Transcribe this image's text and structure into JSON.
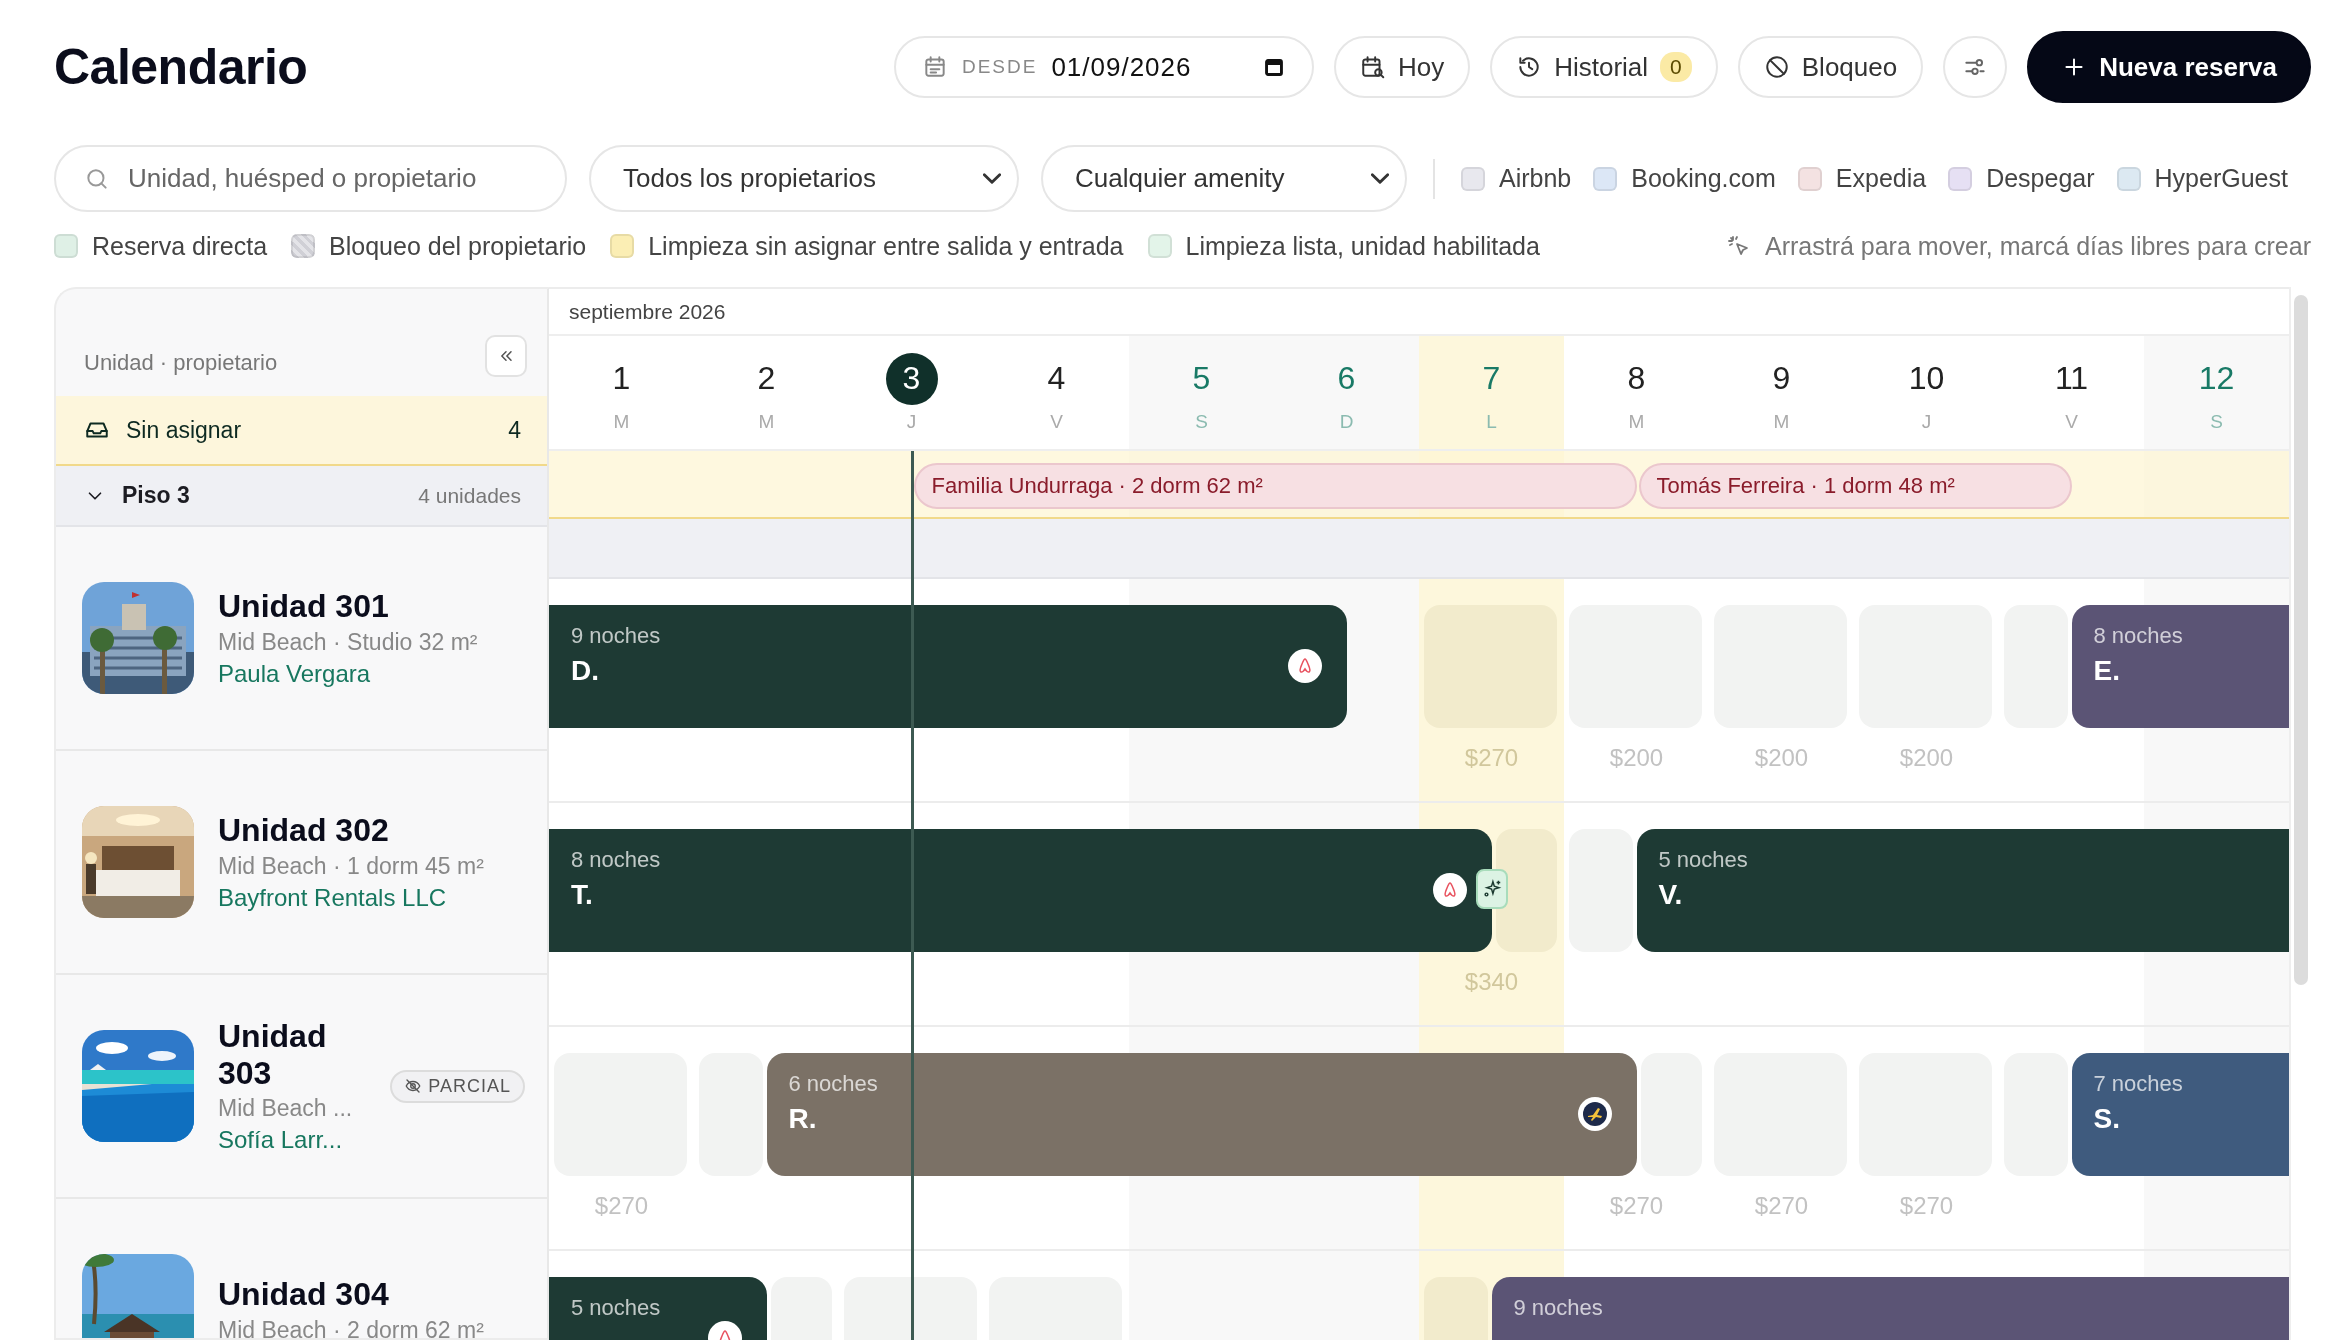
{
  "header": {
    "title": "Calendario",
    "date_field": {
      "label": "DESDE",
      "value": "01/09/2026"
    },
    "buttons": [
      {
        "kind": "today",
        "label": "Hoy"
      },
      {
        "kind": "history",
        "label": "Historial",
        "badge": "0"
      },
      {
        "kind": "block",
        "label": "Bloqueo"
      },
      {
        "kind": "settings"
      },
      {
        "kind": "new",
        "label": "Nueva reserva"
      }
    ]
  },
  "filters": {
    "search": {
      "placeholder": "Unidad, huésped o propietario"
    },
    "selects": [
      {
        "value": "Todos los propietarios"
      },
      {
        "value": "Cualquier amenity"
      }
    ],
    "channels": [
      {
        "label": "Airbnb",
        "color": "#e8e8ee",
        "checked": false
      },
      {
        "label": "Booking.com",
        "color": "#dce7f6",
        "checked": false
      },
      {
        "label": "Expedia",
        "color": "#f4e2e2",
        "checked": false
      },
      {
        "label": "Despegar",
        "color": "#e6e0f4",
        "checked": false
      },
      {
        "label": "HyperGuest",
        "color": "#dce9f2",
        "checked": false
      }
    ]
  },
  "legend": {
    "items": [
      {
        "label": "Reserva directa",
        "kind": "solid",
        "color": "#dff0e6"
      },
      {
        "label": "Bloqueo del propietario",
        "kind": "hatched",
        "color": "#e4e4e8"
      },
      {
        "label": "Limpieza sin asignar entre salida y entrada",
        "kind": "solid",
        "color": "#fbeeb4"
      },
      {
        "label": "Limpieza lista, unidad habilitada",
        "kind": "solid",
        "color": "#e3f4e9"
      }
    ],
    "hint": "Arrastrá para mover, marcá días libres para crear"
  },
  "sidebar": {
    "header": "Unidad · propietario",
    "unassigned": {
      "label": "Sin asignar",
      "count": "4"
    },
    "group": {
      "name": "Piso 3",
      "count": "4 unidades",
      "expanded": true
    },
    "units": [
      {
        "name": "Unidad 301",
        "details": "Mid Beach · Studio 32 m²",
        "owner": "Paula Vergara"
      },
      {
        "name": "Unidad 302",
        "details": "Mid Beach · 1 dorm 45 m²",
        "owner": "Bayfront Rentals LLC"
      },
      {
        "name": "Unidad 303",
        "details": "Mid Beach ...",
        "owner": "Sofía Larr...",
        "badge": "PARCIAL"
      },
      {
        "name": "Unidad 304",
        "details": "Mid Beach · 2 dorm 62 m²"
      }
    ]
  },
  "calendar": {
    "month": "septiembre 2026",
    "days": [
      {
        "number": "1",
        "weekday": "M",
        "weekend": false,
        "holiday": false,
        "today": false
      },
      {
        "number": "2",
        "weekday": "M",
        "weekend": false,
        "holiday": false,
        "today": false
      },
      {
        "number": "3",
        "weekday": "J",
        "weekend": false,
        "holiday": false,
        "today": true
      },
      {
        "number": "4",
        "weekday": "V",
        "weekend": false,
        "holiday": false,
        "today": false
      },
      {
        "number": "5",
        "weekday": "S",
        "weekend": true,
        "holiday": false,
        "today": false
      },
      {
        "number": "6",
        "weekday": "D",
        "weekend": true,
        "holiday": false,
        "today": false
      },
      {
        "number": "7",
        "weekday": "L",
        "weekend": false,
        "holiday": true,
        "today": false
      },
      {
        "number": "8",
        "weekday": "M",
        "weekend": false,
        "holiday": false,
        "today": false
      },
      {
        "number": "9",
        "weekday": "M",
        "weekend": false,
        "holiday": false,
        "today": false
      },
      {
        "number": "10",
        "weekday": "J",
        "weekend": false,
        "holiday": false,
        "today": false
      },
      {
        "number": "11",
        "weekday": "V",
        "weekend": false,
        "holiday": false,
        "today": false
      },
      {
        "number": "12",
        "weekday": "S",
        "weekend": true,
        "holiday": false,
        "today": false
      }
    ],
    "unassigned": {
      "days": [
        {
          "kind": "blank"
        },
        {
          "kind": "blank"
        },
        {
          "kind": "arrival",
          "booking": {
            "label": "Familia Undurraga · 2 dorm 62 m²"
          }
        },
        {
          "kind": "stay"
        },
        {
          "kind": "stay"
        },
        {
          "kind": "stay"
        },
        {
          "kind": "stay"
        },
        {
          "kind": "turnover",
          "booking": {
            "label": "Tomás Ferreira · 1 dorm 48 m²"
          }
        },
        {
          "kind": "stay"
        },
        {
          "kind": "stay"
        },
        {
          "kind": "departure"
        },
        {
          "kind": "blank"
        }
      ]
    },
    "rows": [
      {
        "days": [
          {
            "kind": "stay",
            "booking": {
              "nights": "9 noches",
              "guest": "D.",
              "color": "#1e3a34",
              "kind": "airbnb",
              "flagged": false
            }
          },
          {
            "kind": "stay"
          },
          {
            "kind": "stay"
          },
          {
            "kind": "stay"
          },
          {
            "kind": "stay"
          },
          {
            "kind": "checkout"
          },
          {
            "kind": "free",
            "price": "$270"
          },
          {
            "kind": "free",
            "price": "$200"
          },
          {
            "kind": "free",
            "price": "$200"
          },
          {
            "kind": "free",
            "price": "$200"
          },
          {
            "kind": "arrival",
            "booking": {
              "nights": "8 noches",
              "guest": "E.",
              "color": "#5b5475",
              "kind": "plain",
              "flagged": false
            }
          },
          {
            "kind": "stay"
          }
        ]
      },
      {
        "days": [
          {
            "kind": "stay",
            "booking": {
              "nights": "8 noches",
              "guest": "T.",
              "color": "#1e3a34",
              "kind": "airbnb",
              "flagged": true
            }
          },
          {
            "kind": "stay"
          },
          {
            "kind": "stay"
          },
          {
            "kind": "stay"
          },
          {
            "kind": "stay"
          },
          {
            "kind": "stay"
          },
          {
            "kind": "departure",
            "price": "$340"
          },
          {
            "kind": "arrival",
            "booking": {
              "nights": "5 noches",
              "guest": "V.",
              "color": "#1e3a34",
              "kind": "plain",
              "flagged": false
            }
          },
          {
            "kind": "stay"
          },
          {
            "kind": "stay"
          },
          {
            "kind": "stay"
          },
          {
            "kind": "stay"
          }
        ]
      },
      {
        "days": [
          {
            "kind": "free",
            "price": "$270"
          },
          {
            "kind": "arrival",
            "booking": {
              "nights": "6 noches",
              "guest": "R.",
              "color": "#7b7166",
              "kind": "expedia",
              "flagged": false
            }
          },
          {
            "kind": "stay"
          },
          {
            "kind": "stay"
          },
          {
            "kind": "stay"
          },
          {
            "kind": "stay"
          },
          {
            "kind": "stay"
          },
          {
            "kind": "departure",
            "price": "$270"
          },
          {
            "kind": "free",
            "price": "$270"
          },
          {
            "kind": "free",
            "price": "$270"
          },
          {
            "kind": "arrival",
            "booking": {
              "nights": "7 noches",
              "guest": "S.",
              "color": "#3f5b7e",
              "kind": "plain",
              "flagged": false
            }
          },
          {
            "kind": "stay"
          }
        ]
      },
      {
        "days": [
          {
            "kind": "stay",
            "booking": {
              "nights": "5 noches",
              "color": "#1e3a34",
              "kind": "airbnb",
              "flagged": false
            }
          },
          {
            "kind": "departure"
          },
          {
            "kind": "free"
          },
          {
            "kind": "free"
          },
          {
            "kind": "blank"
          },
          {
            "kind": "blank"
          },
          {
            "kind": "arrival",
            "booking": {
              "nights": "9 noches",
              "color": "#5b5475",
              "kind": "plain",
              "flagged": false
            }
          },
          {
            "kind": "stay"
          },
          {
            "kind": "stay"
          },
          {
            "kind": "stay"
          },
          {
            "kind": "stay"
          },
          {
            "kind": "stay"
          }
        ]
      }
    ]
  }
}
